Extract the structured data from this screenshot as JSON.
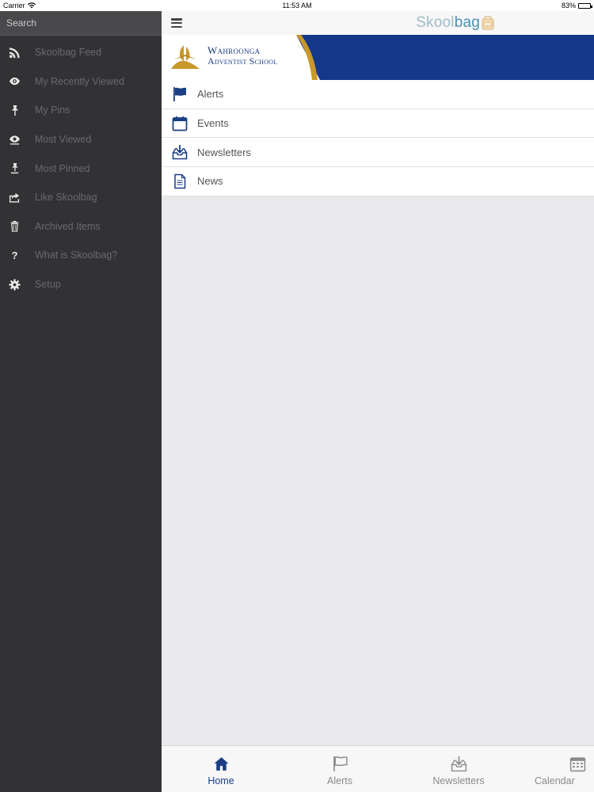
{
  "status_bar": {
    "carrier": "Carrier",
    "time": "11:53 AM",
    "battery": "83%",
    "battery_level": 0.83
  },
  "sidebar": {
    "search_placeholder": "Search",
    "items": [
      {
        "label": "Skoolbag Feed",
        "icon": "rss-icon"
      },
      {
        "label": "My Recently Viewed",
        "icon": "eye-icon"
      },
      {
        "label": "My Pins",
        "icon": "pin-icon"
      },
      {
        "label": "Most Viewed",
        "icon": "eye-multiple-icon"
      },
      {
        "label": "Most Pinned",
        "icon": "pins-icon"
      },
      {
        "label": "Like Skoolbag",
        "icon": "share-icon"
      },
      {
        "label": "Archived Items",
        "icon": "trash-icon"
      },
      {
        "label": "What is Skoolbag?",
        "icon": "question-icon"
      },
      {
        "label": "Setup",
        "icon": "gear-icon"
      }
    ]
  },
  "header": {
    "brand_part1": "Skool",
    "brand_part2": "bag"
  },
  "banner": {
    "school_line1": "Wahroonga",
    "school_line2": "Adventist School"
  },
  "nav": {
    "items": [
      {
        "label": "Alerts",
        "icon": "flag-icon"
      },
      {
        "label": "Events",
        "icon": "calendar-icon"
      },
      {
        "label": "Newsletters",
        "icon": "inbox-download-icon"
      },
      {
        "label": "News",
        "icon": "document-icon"
      }
    ]
  },
  "tabbar": {
    "tabs": [
      {
        "label": "Home",
        "icon": "home-icon",
        "active": true
      },
      {
        "label": "Alerts",
        "icon": "flag-icon",
        "active": false
      },
      {
        "label": "Newsletters",
        "icon": "inbox-download-icon",
        "active": false
      },
      {
        "label": "Calendar",
        "icon": "calendar-icon",
        "active": false
      }
    ]
  },
  "colors": {
    "sidebar_bg": "#323234",
    "accent_blue": "#1c3f84",
    "banner_blue": "#14398a",
    "banner_gold": "#c9982a"
  }
}
